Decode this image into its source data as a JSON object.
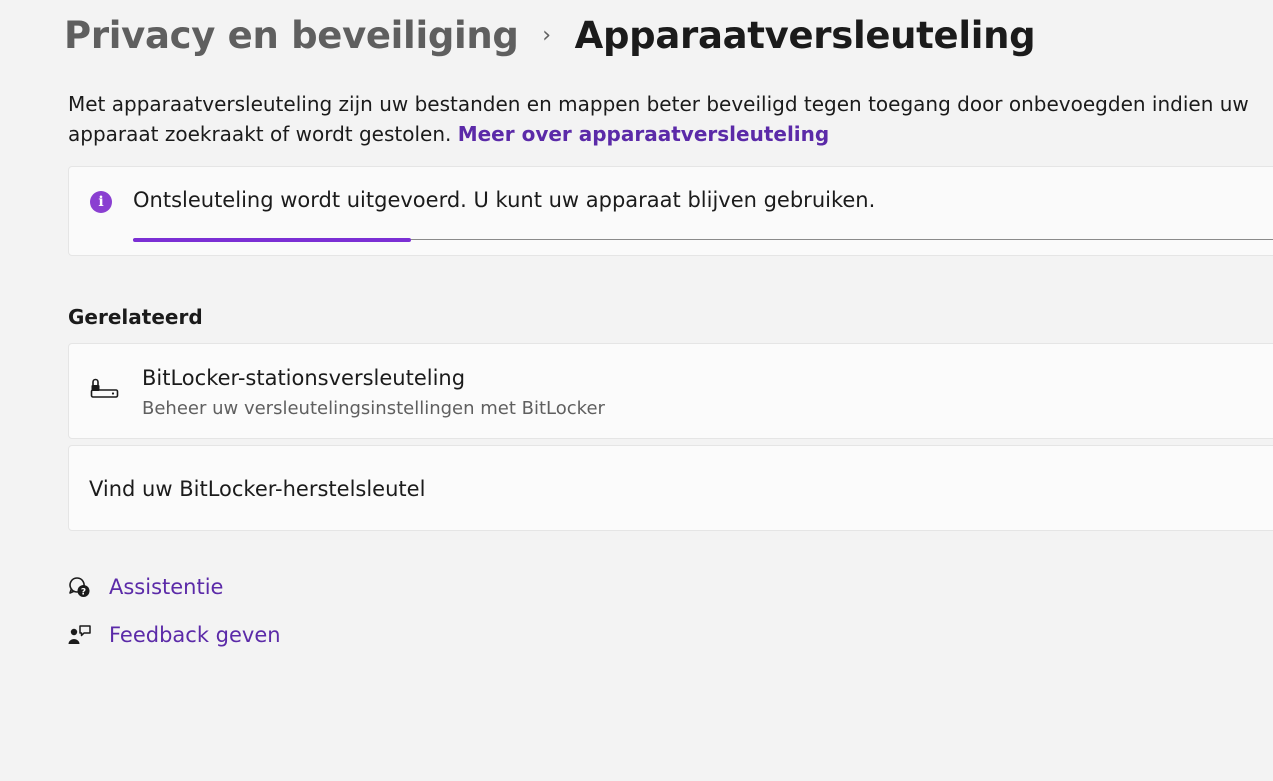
{
  "breadcrumb": {
    "parent": "Privacy en beveiliging",
    "separator": "›",
    "current": "Apparaatversleuteling"
  },
  "description": {
    "line1": "Met apparaatversleuteling zijn uw bestanden en mappen beter beveiligd tegen toegang door onbevoegden indien uw",
    "line2": "apparaat zoekraakt of wordt gestolen.",
    "link": "Meer over apparaatversleuteling"
  },
  "status": {
    "icon": "info-icon",
    "message": "Ontsleuteling wordt uitgevoerd. U kunt uw apparaat blijven gebruiken.",
    "progress_fraction": 0.24,
    "accent": "#7b2fd4"
  },
  "related": {
    "title": "Gerelateerd",
    "items": [
      {
        "icon": "drive-lock-icon",
        "title": "BitLocker-stationsversleuteling",
        "subtitle": "Beheer uw versleutelingsinstellingen met BitLocker"
      },
      {
        "title": "Vind uw BitLocker-herstelsleutel"
      }
    ]
  },
  "help": {
    "assist": {
      "icon": "help-chat-icon",
      "label": "Assistentie"
    },
    "feedback": {
      "icon": "feedback-icon",
      "label": "Feedback geven"
    }
  }
}
